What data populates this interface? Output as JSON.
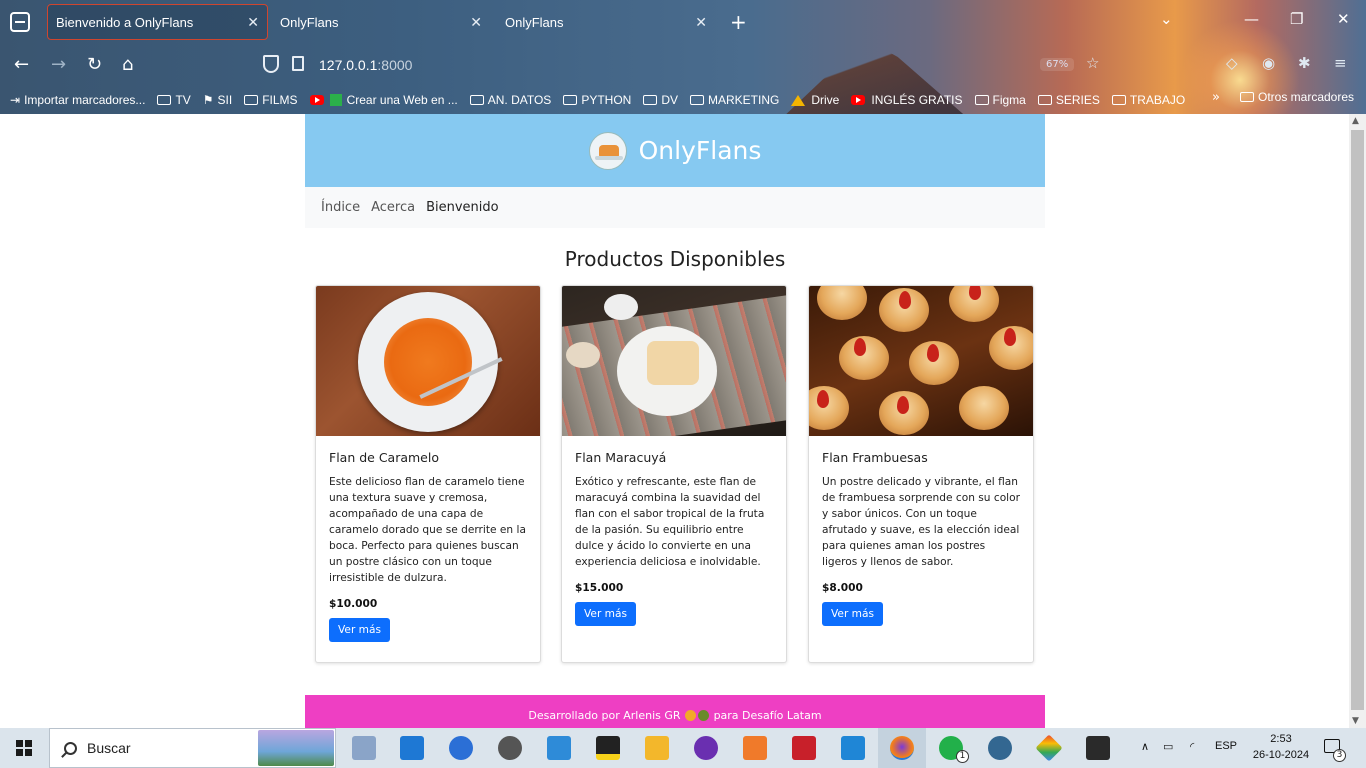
{
  "browser": {
    "tabs": [
      {
        "label": "Bienvenido a OnlyFlans",
        "active": true
      },
      {
        "label": "OnlyFlans",
        "active": false
      },
      {
        "label": "OnlyFlans",
        "active": false
      }
    ],
    "new_tab_glyph": "+",
    "url_host": "127.0.0.1",
    "url_port": ":8000",
    "zoom": "67%",
    "bookmarks": [
      {
        "label": "Importar marcadores...",
        "icon": "import-icon"
      },
      {
        "label": "TV",
        "icon": "folder-icon"
      },
      {
        "label": "SII",
        "icon": "folder-icon"
      },
      {
        "label": "FILMS",
        "icon": "folder-icon"
      },
      {
        "label": "Crear una Web en ...",
        "icon": "youtube-icon"
      },
      {
        "label": "AN. DATOS",
        "icon": "folder-icon"
      },
      {
        "label": "PYTHON",
        "icon": "folder-icon"
      },
      {
        "label": "DV",
        "icon": "folder-icon"
      },
      {
        "label": "MARKETING",
        "icon": "folder-icon"
      },
      {
        "label": "Drive",
        "icon": "drive-icon"
      },
      {
        "label": "INGLÉS GRATIS",
        "icon": "youtube-icon"
      },
      {
        "label": "Figma",
        "icon": "folder-icon"
      },
      {
        "label": "SERIES",
        "icon": "folder-icon"
      },
      {
        "label": "TRABAJO",
        "icon": "folder-icon"
      }
    ],
    "other_bookmarks": "Otros marcadores"
  },
  "site": {
    "brand": "OnlyFlans",
    "nav": [
      "Índice",
      "Acerca",
      "Bienvenido"
    ],
    "section_title": "Productos Disponibles",
    "products": [
      {
        "name": "Flan de Caramelo",
        "description": "Este delicioso flan de caramelo tiene una textura suave y cremosa, acompañado de una capa de caramelo dorado que se derrite en la boca. Perfecto para quienes buscan un postre clásico con un toque irresistible de dulzura.",
        "price": "$10.000",
        "button": "Ver más"
      },
      {
        "name": "Flan Maracuyá",
        "description": "Exótico y refrescante, este flan de maracuyá combina la suavidad del flan con el sabor tropical de la fruta de la pasión. Su equilibrio entre dulce y ácido lo convierte en una experiencia deliciosa e inolvidable.",
        "price": "$15.000",
        "button": "Ver más"
      },
      {
        "name": "Flan Frambuesas",
        "description": "Un postre delicado y vibrante, el flan de frambuesa sorprende con su color y sabor únicos. Con un toque afrutado y suave, es la elección ideal para quienes aman los postres ligeros y llenos de sabor.",
        "price": "$8.000",
        "button": "Ver más"
      }
    ],
    "footer_prefix": "Desarrollado por Arlenis GR",
    "footer_suffix": "para Desafío Latam",
    "colors": {
      "header": "#86c9f1",
      "footer": "#ee3fc3",
      "button": "#0d6efd"
    }
  },
  "taskbar": {
    "search_label": "Buscar",
    "language": "ESP",
    "time": "2:53",
    "date": "26-10-2024",
    "whatsapp_badge": "1",
    "notification_badge": "3"
  }
}
